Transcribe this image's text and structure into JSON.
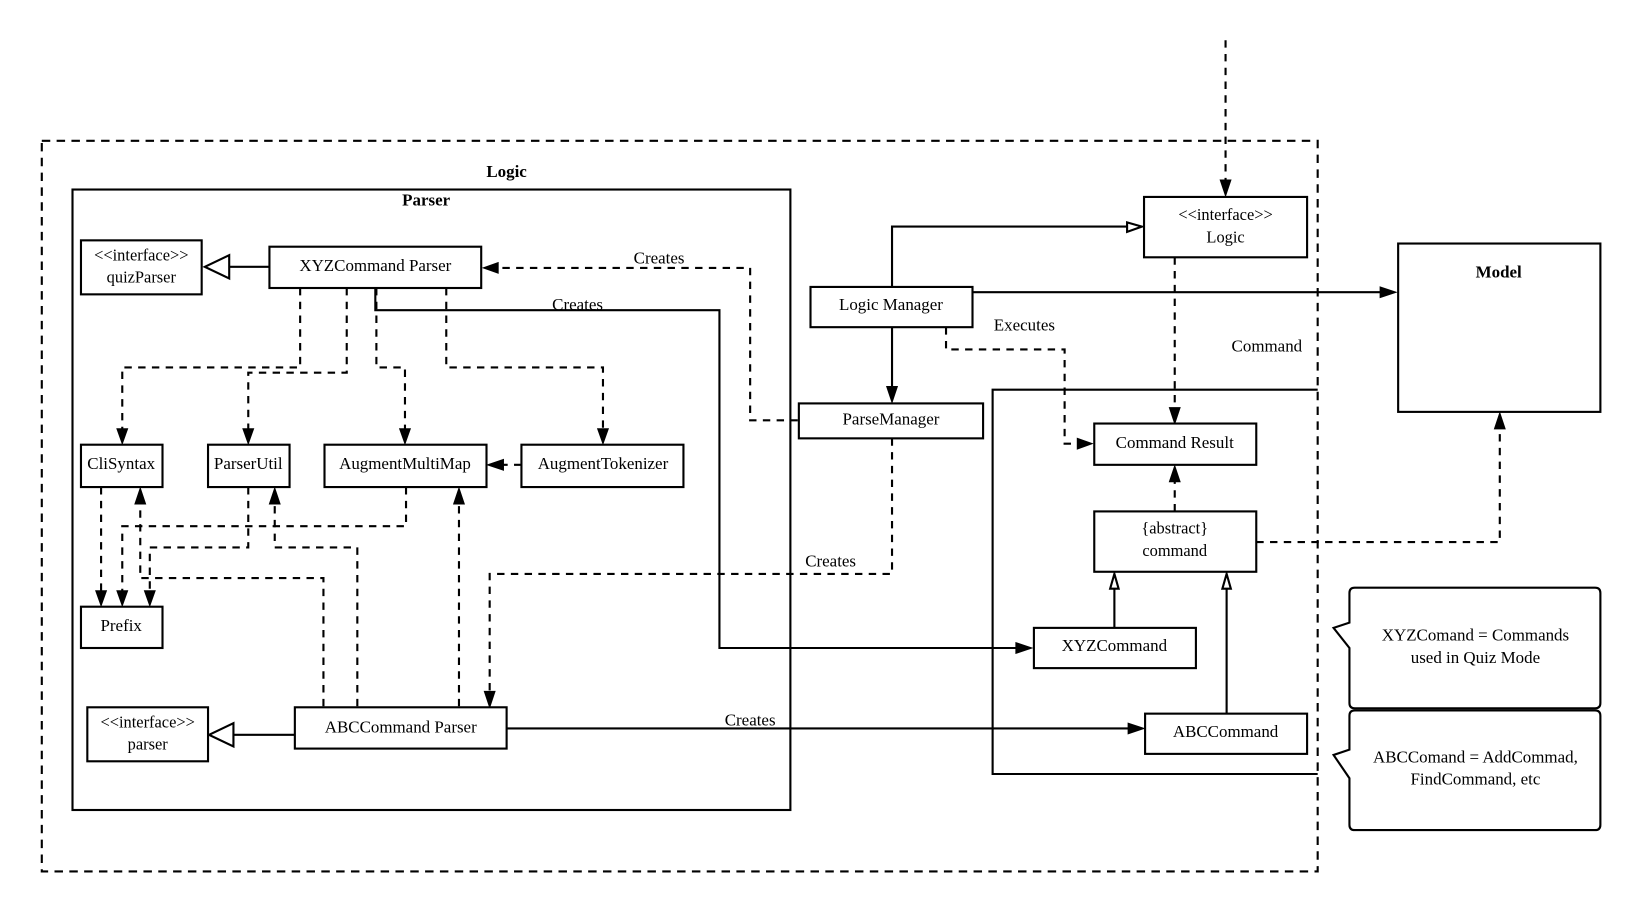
{
  "frames": {
    "logic": "Logic",
    "parser": "Parser",
    "command": "Command",
    "model": "Model"
  },
  "classes": {
    "quiz_parser": {
      "stereotype": "<<interface>>",
      "name": "quizParser"
    },
    "xyz_command_parser": "XYZCommand Parser",
    "cli_syntax": "CliSyntax",
    "parser_util": "ParserUtil",
    "augment_multimap": "AugmentMultiMap",
    "augment_tokenizer": "AugmentTokenizer",
    "prefix": "Prefix",
    "parser_interface": {
      "stereotype": "<<interface>>",
      "name": "parser"
    },
    "abc_command_parser": "ABCCommand Parser",
    "logic_interface": {
      "stereotype": "<<interface>>",
      "name": "Logic"
    },
    "logic_manager": "Logic Manager",
    "parse_manager": "ParseManager",
    "command_result": "Command Result",
    "abstract_command": {
      "stereotype": "{abstract}",
      "name": "command"
    },
    "xyz_command": "XYZCommand",
    "abc_command": "ABCCommand"
  },
  "edge_labels": {
    "creates_parsemanager_to_xyz": "Creates",
    "creates_xyz_to_xyzcommand": "Creates",
    "creates_parsemanager_to_abc": "Creates",
    "creates_abc_to_abccommand": "Creates",
    "executes": "Executes"
  },
  "notes": {
    "xyz_note": [
      "XYZComand = Commands",
      "used in Quiz Mode"
    ],
    "abc_note": [
      "ABCComand = AddCommad,",
      "FindCommand, etc"
    ]
  }
}
